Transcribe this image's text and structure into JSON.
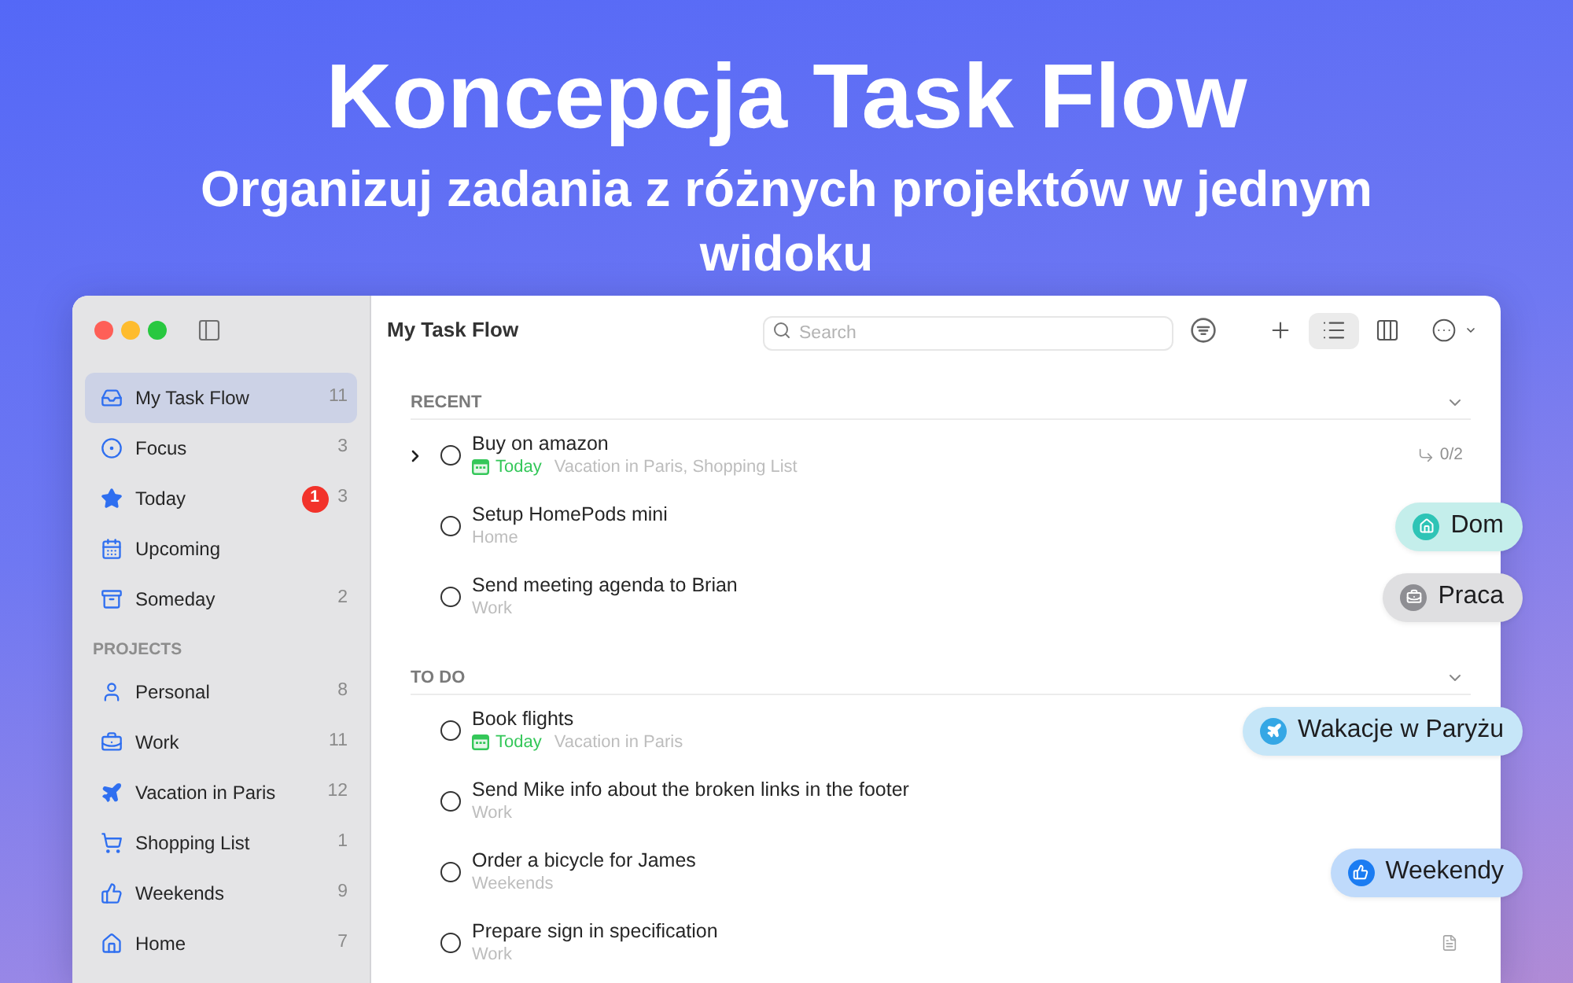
{
  "headline": {
    "title": "Koncepcja Task Flow",
    "subtitle": "Organizuj zadania z różnych projektów w jednym widoku"
  },
  "window": {
    "sidebar": {
      "items": [
        {
          "label": "My Task Flow",
          "count": "11",
          "selected": true
        },
        {
          "label": "Focus",
          "count": "3",
          "selected": false
        },
        {
          "label": "Today",
          "badge": "1",
          "count": "3",
          "selected": false
        },
        {
          "label": "Upcoming",
          "selected": false
        },
        {
          "label": "Someday",
          "count": "2",
          "selected": false
        }
      ],
      "projects": {
        "heading": "PROJECTS",
        "items": [
          {
            "label": "Personal",
            "count": "8",
            "selected": false
          },
          {
            "label": "Work",
            "count": "11",
            "selected": false
          },
          {
            "label": "Vacation in Paris",
            "count": "12",
            "selected": false
          },
          {
            "label": "Shopping List",
            "count": "1",
            "selected": false
          },
          {
            "label": "Weekends",
            "count": "9",
            "selected": false
          },
          {
            "label": "Home",
            "count": "7",
            "selected": false
          }
        ]
      }
    },
    "toolbar": {
      "title": "My Task Flow",
      "search": {
        "placeholder": "Search"
      },
      "view_buttons": [
        {
          "kind": "list",
          "selected": true
        },
        {
          "kind": "columns",
          "selected": false
        }
      ]
    },
    "sections": [
      {
        "heading": "RECENT",
        "expanded": true,
        "tasks": [
          {
            "title": "Buy on amazon",
            "checked": false,
            "due": "Today",
            "projects": "Vacation in Paris, Shopping List",
            "subtasks": {
              "progress": "0/2",
              "expanded": false
            },
            "note": false
          },
          {
            "title": "Setup HomePods mini",
            "checked": false,
            "projects": "Home",
            "note": false,
            "callout": {
              "label": "Dom",
              "color": "#2ec4b6"
            }
          },
          {
            "title": "Send meeting agenda to Brian",
            "checked": false,
            "projects": "Work",
            "note": false,
            "callout": {
              "label": "Praca",
              "color": "#8e8e93"
            }
          }
        ]
      },
      {
        "heading": "TO DO",
        "expanded": true,
        "tasks": [
          {
            "title": "Book flights",
            "checked": false,
            "due": "Today",
            "projects": "Vacation in Paris",
            "note": false,
            "callout": {
              "label": "Wakacje w Paryżu",
              "color": "#35a7e5"
            }
          },
          {
            "title": "Send Mike info about the broken links in the footer",
            "checked": false,
            "projects": "Work",
            "note": false
          },
          {
            "title": "Order a bicycle for James",
            "checked": false,
            "projects": "Weekends",
            "note": false,
            "callout": {
              "label": "Weekendy",
              "color": "#1b7cf2"
            }
          },
          {
            "title": "Prepare sign in specification",
            "checked": false,
            "projects": "Work",
            "note": true
          }
        ]
      }
    ]
  }
}
